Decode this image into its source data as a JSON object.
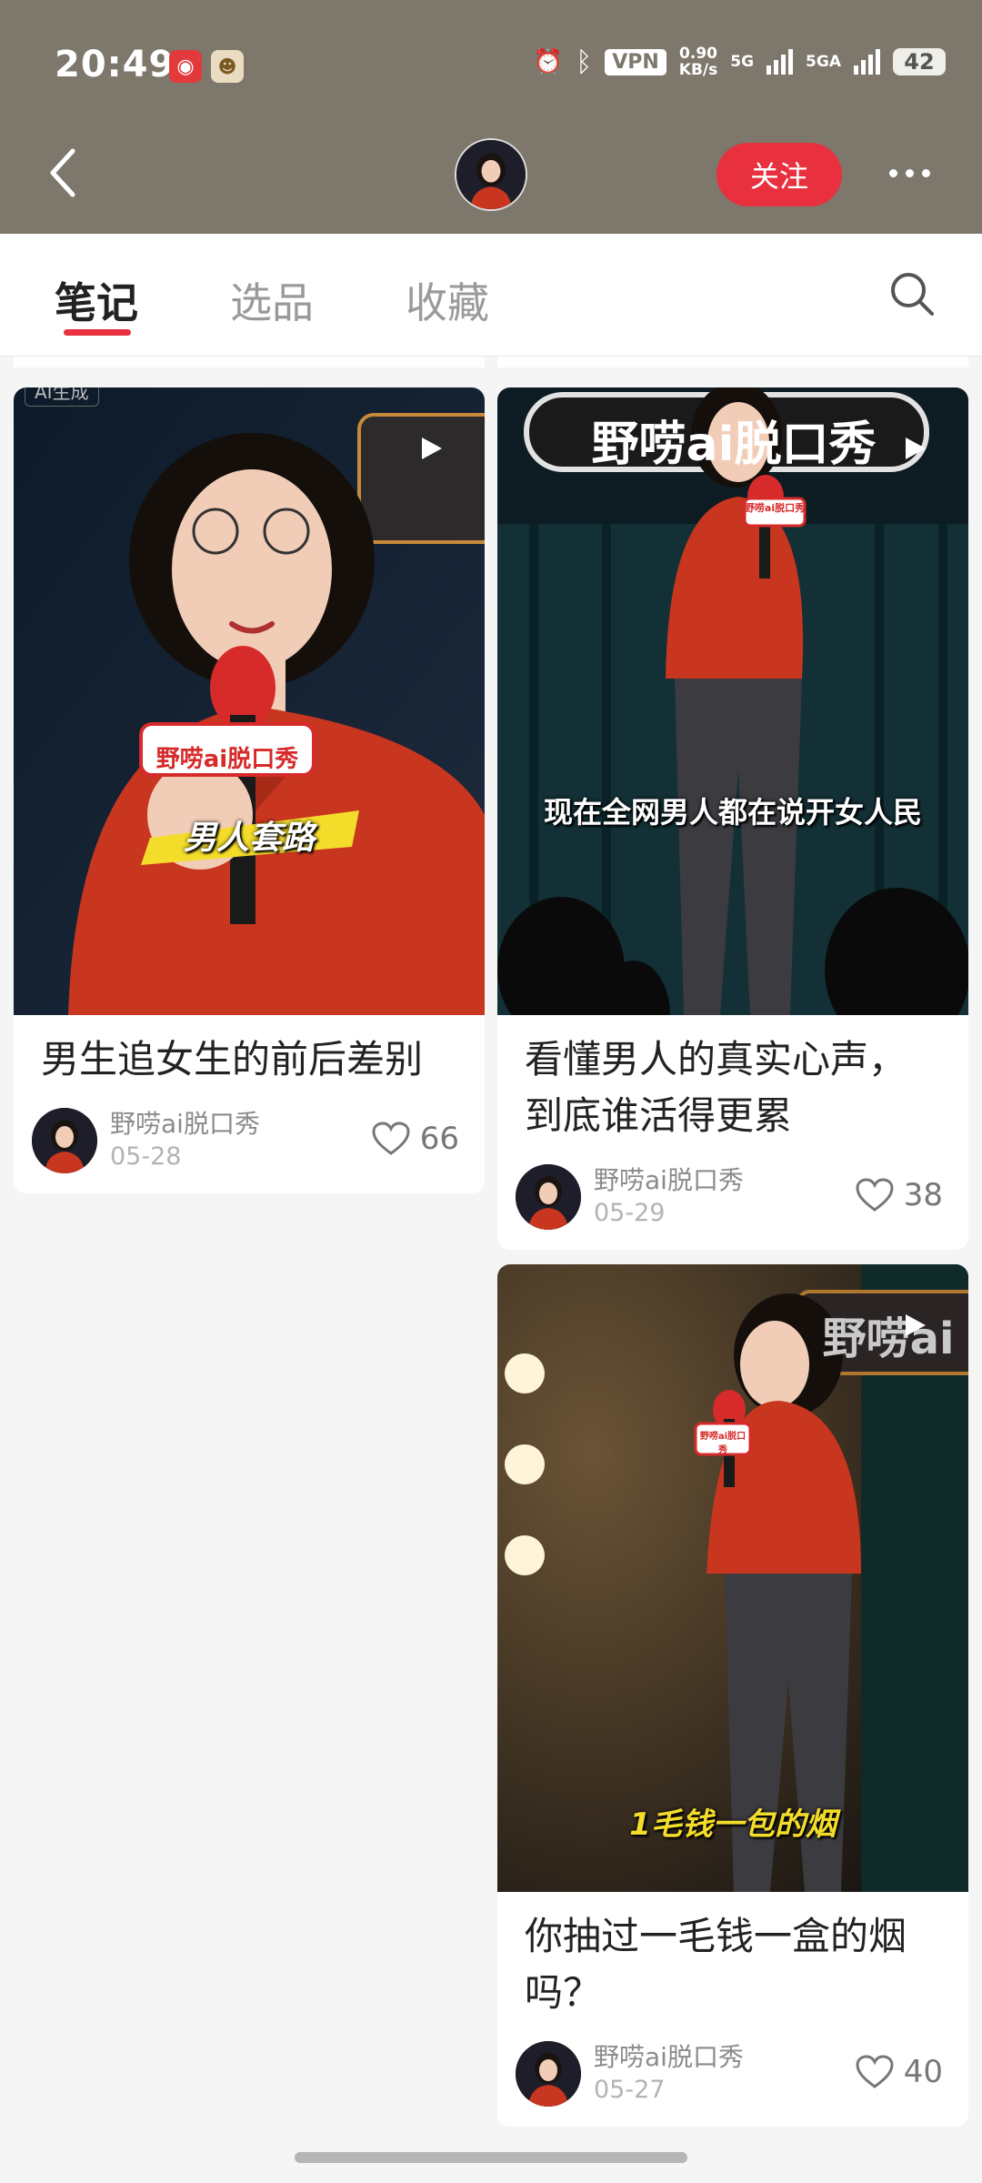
{
  "status_bar": {
    "time": "20:49",
    "vpn": "VPN",
    "net_speed_value": "0.90",
    "net_speed_unit": "KB/s",
    "signal1": "5G",
    "signal2": "5GA",
    "battery": "42"
  },
  "header": {
    "follow_label": "关注"
  },
  "tabs": [
    {
      "label": "笔记",
      "active": true
    },
    {
      "label": "选品",
      "active": false
    },
    {
      "label": "收藏",
      "active": false
    }
  ],
  "notes": [
    {
      "title": "男生追女生的前后差别",
      "author": "野唠ai脱口秀",
      "date": "05-28",
      "likes": "66",
      "cover_badge": "AI生成",
      "cover_mic_label": "野唠ai脱口秀",
      "cover_caption": "男人套路"
    },
    {
      "title": "看懂男人的真实心声，到底谁活得更累",
      "author": "野唠ai脱口秀",
      "date": "05-29",
      "likes": "38",
      "cover_sign": "野唠ai脱口秀",
      "cover_mic_label": "野唠ai脱口秀",
      "cover_caption": "现在全网男人都在说开女人民"
    },
    {
      "title": "你抽过一毛钱一盒的烟吗？",
      "author": "野唠ai脱口秀",
      "date": "05-27",
      "likes": "40",
      "cover_sign": "野唠ai",
      "cover_mic_label": "野唠ai脱口秀",
      "cover_caption": "1毛钱一包的烟"
    }
  ],
  "colors": {
    "header_bg": "#7d776c",
    "accent": "#e8303f",
    "shirt": "#c8361f"
  }
}
